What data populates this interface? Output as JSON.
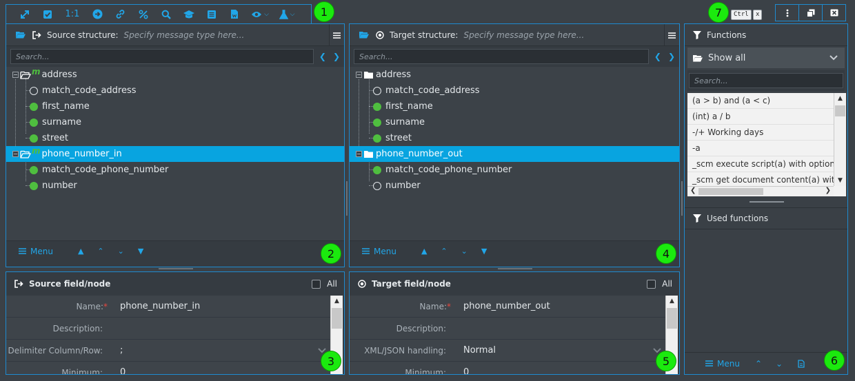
{
  "toolbar": {
    "badge": "1",
    "one_to_one_label": "1:1",
    "icons": [
      "expand-icon",
      "check-square-icon",
      "one-to-one",
      "arrow-circle-right-icon",
      "link-icon",
      "percent-icon",
      "search-icon",
      "graduation-cap-icon",
      "list-icon",
      "document-icon",
      "eye-icon",
      "flask-icon"
    ]
  },
  "top_right": {
    "badge": "7",
    "ctrl_key": "Ctrl",
    "x_key": "x"
  },
  "source": {
    "title": "Source structure:",
    "placeholder": "Specify message type here...",
    "search_placeholder": "Search...",
    "badge": "2",
    "menu_label": "Menu",
    "tree": [
      {
        "label": "address",
        "kind": "group"
      },
      {
        "label": "match_code_address",
        "kind": "hollow"
      },
      {
        "label": "first_name",
        "kind": "filled"
      },
      {
        "label": "surname",
        "kind": "filled"
      },
      {
        "label": "street",
        "kind": "filled"
      },
      {
        "label": "phone_number_in",
        "kind": "group"
      },
      {
        "label": "match_code_phone_number",
        "kind": "filled"
      },
      {
        "label": "number",
        "kind": "filled"
      }
    ],
    "group_marker": "m"
  },
  "target": {
    "title": "Target structure:",
    "placeholder": "Specify message type here...",
    "search_placeholder": "Search...",
    "badge": "4",
    "menu_label": "Menu",
    "tree": [
      {
        "label": "address",
        "kind": "group"
      },
      {
        "label": "match_code_address",
        "kind": "hollow"
      },
      {
        "label": "first_name",
        "kind": "filled"
      },
      {
        "label": "surname",
        "kind": "filled"
      },
      {
        "label": "street",
        "kind": "filled"
      },
      {
        "label": "phone_number_out",
        "kind": "group"
      },
      {
        "label": "match_code_phone_number",
        "kind": "filled"
      },
      {
        "label": "number",
        "kind": "hollow"
      }
    ]
  },
  "source_field": {
    "title": "Source field/node",
    "all_label": "All",
    "badge": "3",
    "rows": [
      {
        "label": "Name:",
        "required": "*",
        "value": "phone_number_in"
      },
      {
        "label": "Description:",
        "value": ""
      },
      {
        "label": "Delimiter Column/Row:",
        "value": ";"
      },
      {
        "label": "Minimum:",
        "value": "0"
      }
    ]
  },
  "target_field": {
    "title": "Target field/node",
    "all_label": "All",
    "badge": "5",
    "rows": [
      {
        "label": "Name:",
        "required": "*",
        "value": "phone_number_out"
      },
      {
        "label": "Description:",
        "value": ""
      },
      {
        "label": "XML/JSON handling:",
        "value": "Normal"
      },
      {
        "label": "Minimum:",
        "value": "0"
      }
    ]
  },
  "functions": {
    "title": "Functions",
    "show_all_label": "Show all",
    "search_placeholder": "Search...",
    "items": [
      "(a > b) and (a < c)",
      "(int) a / b",
      "-/+ Working days",
      "-a",
      "_scm execute script(a) with optiona",
      "_scm get document content(a) with"
    ],
    "used_title": "Used functions",
    "menu_label": "Menu",
    "badge": "6"
  },
  "colors": {
    "accent": "#21a6e8",
    "selection": "#08a4e0",
    "badge": "#1bea0e",
    "filled_dot": "#4fbe3f"
  }
}
